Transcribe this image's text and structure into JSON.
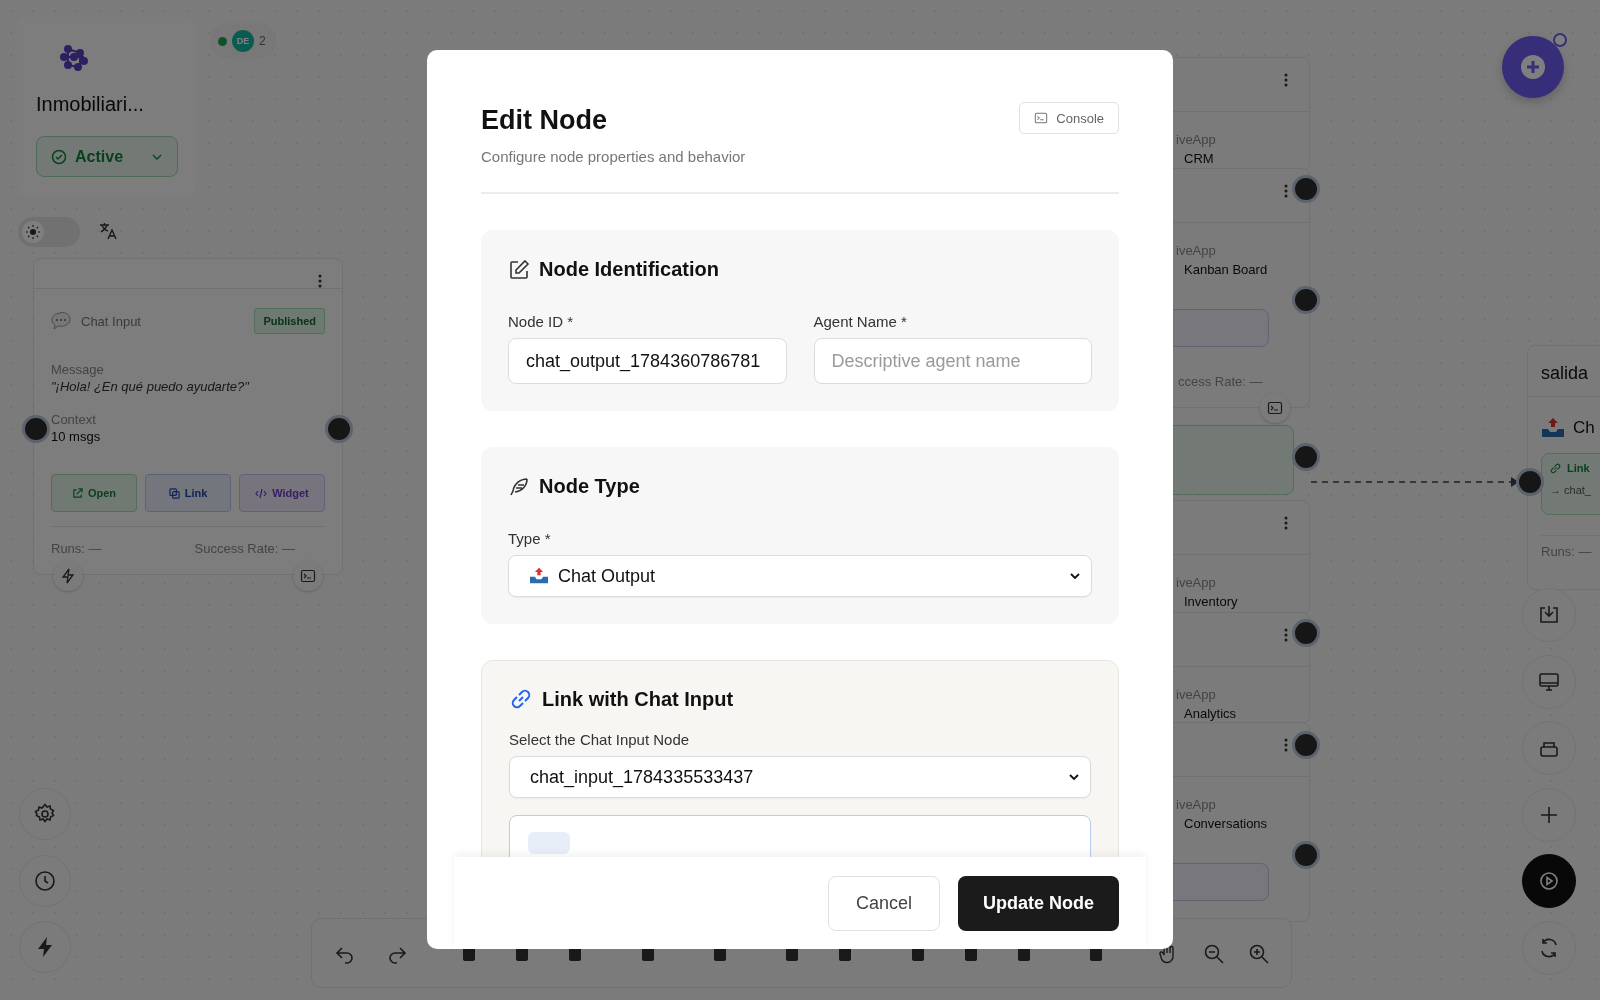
{
  "project": {
    "name": "Inmobiliari...",
    "status": "Active"
  },
  "presence": {
    "initials": "DE",
    "count": "2"
  },
  "theme_toggle": {
    "on": false
  },
  "chat_input_node": {
    "title": "Chat Input",
    "badge": "Published",
    "message_label": "Message",
    "message": "\"¡Hola! ¿En qué puedo ayudarte?\"",
    "context_label": "Context",
    "context": "10 msgs",
    "actions": [
      "Open",
      "Link",
      "Widget"
    ],
    "runs": "Runs: —",
    "success_rate": "Success Rate: —"
  },
  "app_nodes": [
    {
      "app": "iveApp",
      "name": "CRM"
    },
    {
      "app": "iveApp",
      "name": "Kanban Board",
      "success_rate": "ccess Rate: —"
    },
    {
      "app": "iveApp",
      "name": "Inventory"
    },
    {
      "app": "iveApp",
      "name": "Analytics"
    },
    {
      "app": "iveApp",
      "name": "Conversations"
    }
  ],
  "output_node": {
    "title": "salida",
    "type": "Ch",
    "link": "Link",
    "target": "→ chat_",
    "runs": "Runs: —"
  },
  "modal": {
    "title": "Edit Node",
    "subtitle": "Configure node properties and behavior",
    "console": "Console",
    "identification": {
      "title": "Node Identification",
      "node_id_label": "Node ID *",
      "node_id": "chat_output_1784360786781",
      "agent_name_label": "Agent Name *",
      "agent_name_placeholder": "Descriptive agent name"
    },
    "node_type": {
      "title": "Node Type",
      "type_label": "Type *",
      "type": "Chat Output"
    },
    "link": {
      "title": "Link with Chat Input",
      "select_label": "Select the Chat Input Node",
      "selected": "chat_input_1784335533437"
    },
    "buttons": {
      "cancel": "Cancel",
      "submit": "Update Node"
    }
  }
}
